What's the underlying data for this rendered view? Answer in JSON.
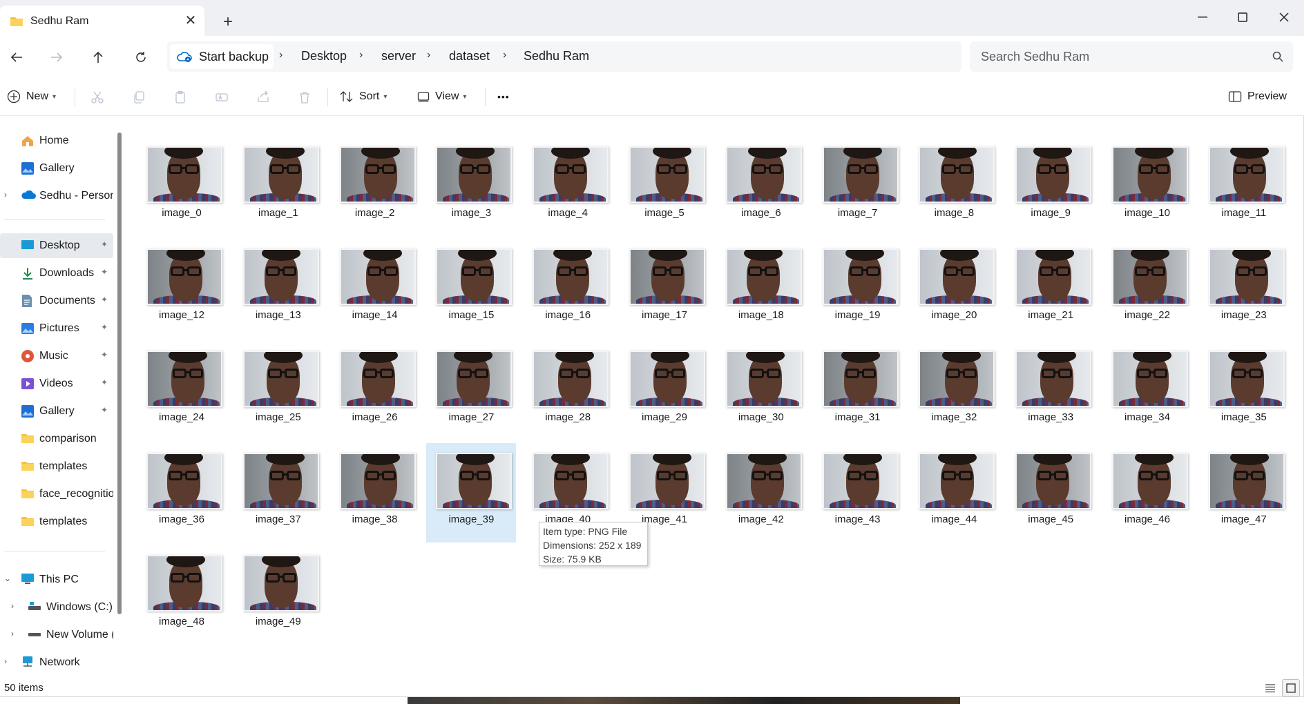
{
  "window": {
    "tab_title": "Sedhu Ram",
    "new_tab_label": "+",
    "close_tab_label": "✕",
    "minimize_label": "—",
    "maximize_label": "☐",
    "close_label": "✕"
  },
  "address": {
    "backup_label": "Start backup",
    "breadcrumbs": [
      "Desktop",
      "server",
      "dataset",
      "Sedhu Ram"
    ],
    "separator": "›"
  },
  "search": {
    "placeholder": "Search Sedhu Ram"
  },
  "toolbar": {
    "new_label": "New",
    "sort_label": "Sort",
    "view_label": "View",
    "more_label": "•••",
    "preview_label": "Preview"
  },
  "sidebar": {
    "items": [
      {
        "label": "Home",
        "icon": "home-icon"
      },
      {
        "label": "Gallery",
        "icon": "gallery-icon"
      },
      {
        "label": "Sedhu - Persona",
        "icon": "cloud-icon"
      },
      {
        "label": "Desktop",
        "icon": "desktop-icon"
      },
      {
        "label": "Downloads",
        "icon": "download-icon"
      },
      {
        "label": "Documents",
        "icon": "document-icon"
      },
      {
        "label": "Pictures",
        "icon": "pictures-icon"
      },
      {
        "label": "Music",
        "icon": "music-icon"
      },
      {
        "label": "Videos",
        "icon": "video-icon"
      },
      {
        "label": "Gallery",
        "icon": "gallery-icon"
      },
      {
        "label": "comparison",
        "icon": "folder-icon"
      },
      {
        "label": "templates",
        "icon": "folder-icon"
      },
      {
        "label": "face_recognitior",
        "icon": "folder-icon"
      },
      {
        "label": "templates",
        "icon": "folder-icon"
      },
      {
        "label": "This PC",
        "icon": "pc-icon"
      },
      {
        "label": "Windows (C:)",
        "icon": "drive-icon"
      },
      {
        "label": "New Volume (I",
        "icon": "drive-icon"
      },
      {
        "label": "Network",
        "icon": "network-icon"
      }
    ],
    "pin_glyph": "📌"
  },
  "files": [
    "image_0",
    "image_1",
    "image_2",
    "image_3",
    "image_4",
    "image_5",
    "image_6",
    "image_7",
    "image_8",
    "image_9",
    "image_10",
    "image_11",
    "image_12",
    "image_13",
    "image_14",
    "image_15",
    "image_16",
    "image_17",
    "image_18",
    "image_19",
    "image_20",
    "image_21",
    "image_22",
    "image_23",
    "image_24",
    "image_25",
    "image_26",
    "image_27",
    "image_28",
    "image_29",
    "image_30",
    "image_31",
    "image_32",
    "image_33",
    "image_34",
    "image_35",
    "image_36",
    "image_37",
    "image_38",
    "image_39",
    "image_40",
    "image_41",
    "image_42",
    "image_43",
    "image_44",
    "image_45",
    "image_46",
    "image_47",
    "image_48",
    "image_49"
  ],
  "selected_file": "image_39",
  "tooltip": {
    "type": "Item type: PNG File",
    "dimensions": "Dimensions: 252 x 189",
    "size": "Size: 75.9 KB"
  },
  "status": {
    "count": "50 items"
  },
  "colors": {
    "selection": "#d9ebf9",
    "accent": "#0067c0"
  }
}
